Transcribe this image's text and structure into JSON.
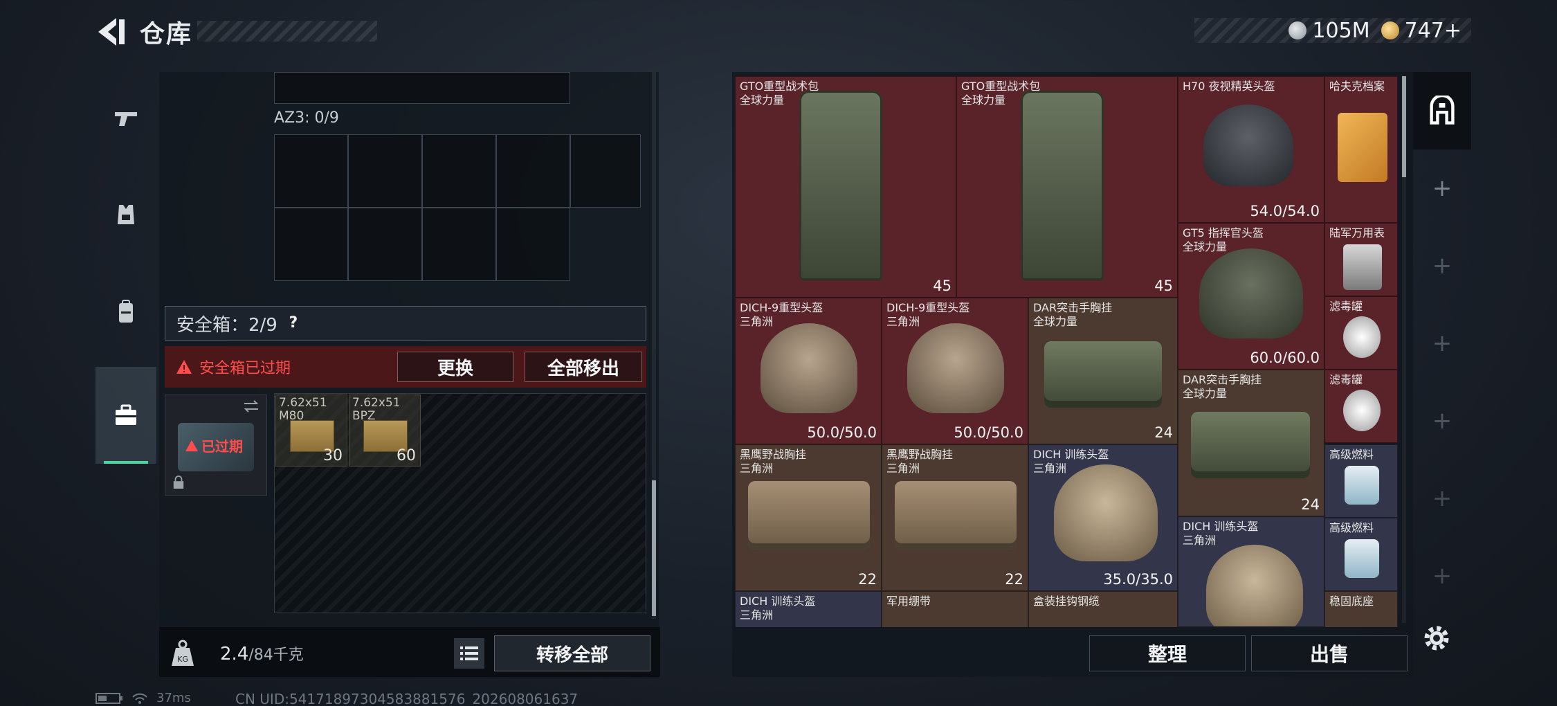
{
  "header": {
    "title": "仓库",
    "currency": [
      {
        "icon": "silver-coin-icon",
        "amount": "105M"
      },
      {
        "icon": "gold-coin-icon",
        "amount": "747+"
      }
    ]
  },
  "categories": [
    {
      "name": "weapons",
      "icon": "pistol-icon"
    },
    {
      "name": "armor",
      "icon": "armor-vest-icon"
    },
    {
      "name": "backpack",
      "icon": "backpack-icon"
    },
    {
      "name": "safebox",
      "icon": "briefcase-icon",
      "active": true
    }
  ],
  "left_panel": {
    "az3_label": "AZ3: 0/9",
    "safebox_label": "安全箱：2/9",
    "help": "?",
    "alert_text": "安全箱已过期",
    "replace_button": "更换",
    "move_all_out_button": "全部移出",
    "expired_tag": "已过期",
    "ammo": [
      {
        "name": "7.62x51\nM80",
        "count": "30"
      },
      {
        "name": "7.62x51\nBPZ",
        "count": "60"
      }
    ],
    "weight_value": "2.4",
    "weight_max": "/84千克",
    "transfer_all_button": "转移全部"
  },
  "stash_items": [
    {
      "name": "GTO重型战术包\n全球力量",
      "value": "45",
      "color": "red"
    },
    {
      "name": "GTO重型战术包\n全球力量",
      "value": "45",
      "color": "red"
    },
    {
      "name": "H70 夜视精英头盔",
      "value": "54.0/54.0",
      "color": "red"
    },
    {
      "name": "哈夫克档案",
      "value": "",
      "color": "red"
    },
    {
      "name": "GT5 指挥官头盔\n全球力量",
      "value": "60.0/60.0",
      "color": "red"
    },
    {
      "name": "陆军万用表",
      "value": "",
      "color": "red"
    },
    {
      "name": "DICH-9重型头盔\n三角洲",
      "value": "50.0/50.0",
      "color": "red"
    },
    {
      "name": "DICH-9重型头盔\n三角洲",
      "value": "50.0/50.0",
      "color": "red"
    },
    {
      "name": "DAR突击手胸挂\n全球力量",
      "value": "24",
      "color": "brown"
    },
    {
      "name": "滤毒罐",
      "value": "",
      "color": "red"
    },
    {
      "name": "DAR突击手胸挂\n全球力量",
      "value": "24",
      "color": "brown"
    },
    {
      "name": "滤毒罐",
      "value": "",
      "color": "red"
    },
    {
      "name": "黑鹰野战胸挂\n三角洲",
      "value": "22",
      "color": "brown"
    },
    {
      "name": "黑鹰野战胸挂\n三角洲",
      "value": "22",
      "color": "brown"
    },
    {
      "name": "DICH 训练头盔\n三角洲",
      "value": "35.0/35.0",
      "color": "blue"
    },
    {
      "name": "高级燃料",
      "value": "",
      "color": "blue"
    },
    {
      "name": "DICH 训练头盔\n三角洲",
      "value": "",
      "color": "blue"
    },
    {
      "name": "高级燃料",
      "value": "",
      "color": "blue"
    },
    {
      "name": "DICH 训练头盔\n三角洲",
      "value": "",
      "color": "blue"
    },
    {
      "name": "军用绷带",
      "value": "",
      "color": "brown"
    },
    {
      "name": "盒装挂钩钢缆",
      "value": "",
      "color": "brown"
    },
    {
      "name": "稳固底座",
      "value": "",
      "color": "brown"
    }
  ],
  "right_panel": {
    "organize_button": "整理",
    "sell_button": "出售"
  },
  "status_bar": {
    "ping": "37ms",
    "uid": "CN UID:541718973045838815​76_202608061637"
  }
}
